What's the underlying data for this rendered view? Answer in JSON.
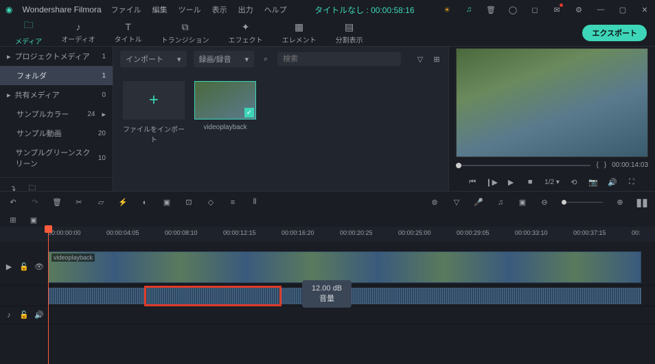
{
  "app": {
    "name": "Wondershare Filmora",
    "title": "タイトルなし : 00:00:58:16"
  },
  "menu": [
    "ファイル",
    "編集",
    "ツール",
    "表示",
    "出力",
    "ヘルプ"
  ],
  "tabs": [
    {
      "label": "メディア"
    },
    {
      "label": "オーディオ"
    },
    {
      "label": "タイトル"
    },
    {
      "label": "トランジション"
    },
    {
      "label": "エフェクト"
    },
    {
      "label": "エレメント"
    },
    {
      "label": "分割表示"
    }
  ],
  "export_label": "エクスポート",
  "sidebar": {
    "items": [
      {
        "label": "プロジェクトメディア",
        "count": "1",
        "chev": true
      },
      {
        "label": "フォルダ",
        "count": "1",
        "active": true
      },
      {
        "label": "共有メディア",
        "count": "0",
        "chev": true
      },
      {
        "label": "サンプルカラー",
        "count": "24",
        "arrow": true
      },
      {
        "label": "サンプル動画",
        "count": "20"
      },
      {
        "label": "サンプルグリーンスクリーン",
        "count": "10"
      }
    ]
  },
  "browser": {
    "import_label": "インポート",
    "record_label": "録画/録音",
    "search_placeholder": "検索",
    "import_tile": "ファイルをインポート",
    "clip_name": "videoplayback"
  },
  "preview": {
    "time": "00:00:14:03",
    "speed": "1/2",
    "braces_l": "{",
    "braces_r": "}"
  },
  "timeline": {
    "ticks": [
      "00:00:00:00",
      "00:00:04:05",
      "00:00:08:10",
      "00:00:12:15",
      "00:00:16:20",
      "00:00:20:25",
      "00:00:25:00",
      "00:00:29:05",
      "00:00:33:10",
      "00:00:37:15",
      "00:"
    ],
    "clip_label": "videoplayback",
    "tooltip_value": "12.00 dB",
    "tooltip_label": "音量"
  }
}
